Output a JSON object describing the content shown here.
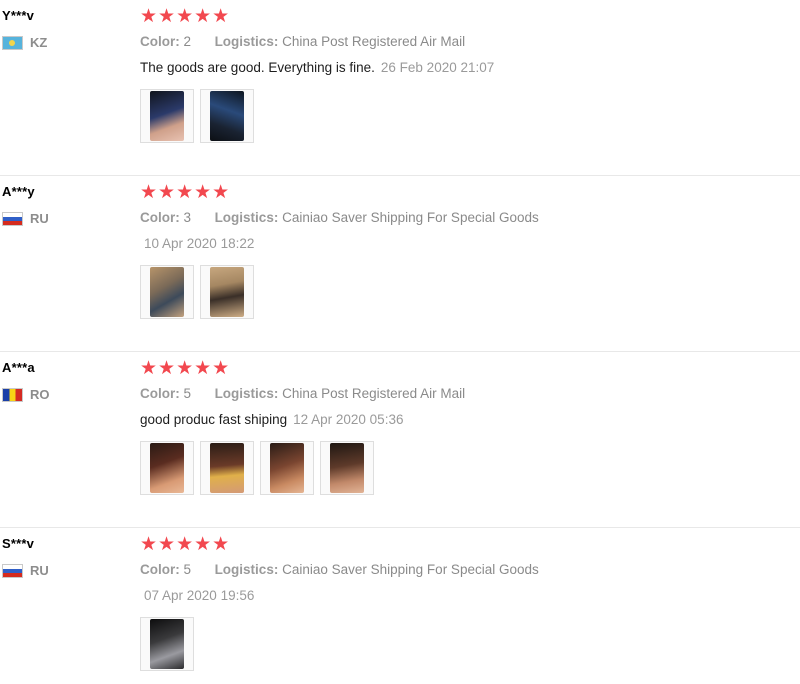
{
  "reviews": [
    {
      "user": "Y***v",
      "country": "KZ",
      "flag": "kz",
      "stars": "★★★★★",
      "color_label": "Color:",
      "color_value": "2",
      "logistics_label": "Logistics:",
      "logistics_value": "China Post Registered Air Mail",
      "text": "The goods are good. Everything is fine.",
      "date": "26 Feb 2020 21:07",
      "photos": 2
    },
    {
      "user": "A***y",
      "country": "RU",
      "flag": "ru",
      "stars": "★★★★★",
      "color_label": "Color:",
      "color_value": "3",
      "logistics_label": "Logistics:",
      "logistics_value": "Cainiao Saver Shipping For Special Goods",
      "text": "",
      "date": "10 Apr 2020 18:22",
      "photos": 2
    },
    {
      "user": "A***a",
      "country": "RO",
      "flag": "ro",
      "stars": "★★★★★",
      "color_label": "Color:",
      "color_value": "5",
      "logistics_label": "Logistics:",
      "logistics_value": "China Post Registered Air Mail",
      "text": "good produc fast shiping",
      "date": "12 Apr 2020 05:36",
      "photos": 4
    },
    {
      "user": "S***v",
      "country": "RU",
      "flag": "ru",
      "stars": "★★★★★",
      "color_label": "Color:",
      "color_value": "5",
      "logistics_label": "Logistics:",
      "logistics_value": "Cainiao Saver Shipping For Special Goods",
      "text": "",
      "date": "07 Apr 2020 19:56",
      "photos": 1
    }
  ]
}
